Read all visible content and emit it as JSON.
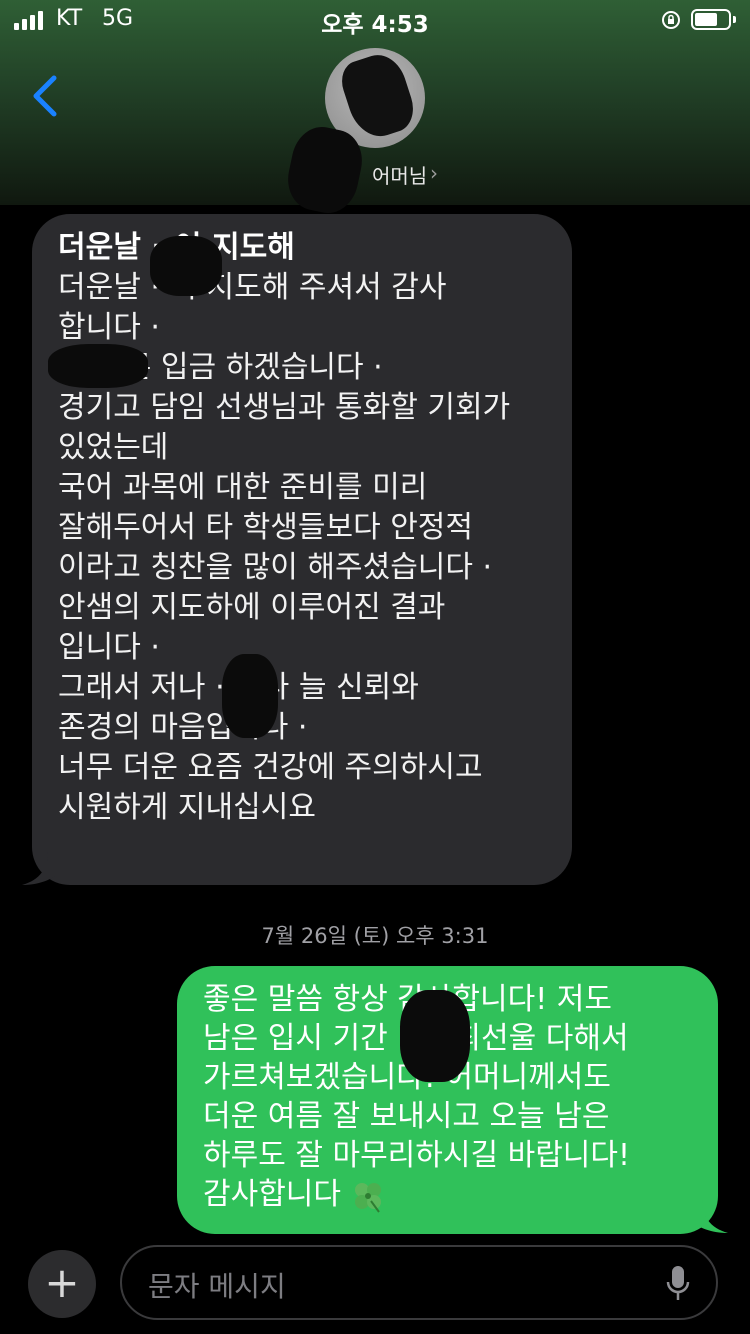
{
  "status_bar": {
    "carrier": "KT",
    "network": "5G",
    "time": "오후 4:53"
  },
  "header": {
    "contact_name": "어머님",
    "back_icon": "chevron-left-icon",
    "chevron_icon": "chevron-right-icon"
  },
  "incoming_message": {
    "title": "더운날 ··이 지도해",
    "lines": [
      "더운날 ··이  지도해 주셔서  감사",
      "합니다 ·",
      "··· 빠른 입금 하겠습니다 ·",
      "경기고  담임 선생님과 통화할 기회가",
      "있었는데",
      "국어  과목에 대한 준비를 미리",
      "잘해두어서 타 학생들보다  안정적",
      "이라고 칭찬을  많이 해주셨습니다 ·",
      "안샘의 지도하에 이루어진 결과",
      "입니다 ·",
      "그래서  저나 ··이나 늘  신뢰와",
      "존경의  마음입니다 ·",
      "너무 더운  요즘 건강에  주의하시고",
      "시원하게 지내십시요"
    ]
  },
  "timestamp": "7월 26일 (토) 오후 3:31",
  "outgoing_message": {
    "lines": [
      "좋은 말씀 항상 감사합니다! 저도",
      "남은 입시 기간 ··이 최선울 다해서",
      "가르쳐보겠습니다! 어머니께서도",
      "더운 여름 잘 보내시고 오늘 남은",
      "하루도 잘 마무리하시길 바랍니다!",
      "감사합니다"
    ],
    "emoji": "four-leaf-clover-icon"
  },
  "input_bar": {
    "placeholder": "문자 메시지",
    "plus_label": "+"
  },
  "colors": {
    "outgoing_bubble": "#30c15a",
    "incoming_bubble": "#2b2b2e",
    "accent": "#1a82ff"
  }
}
